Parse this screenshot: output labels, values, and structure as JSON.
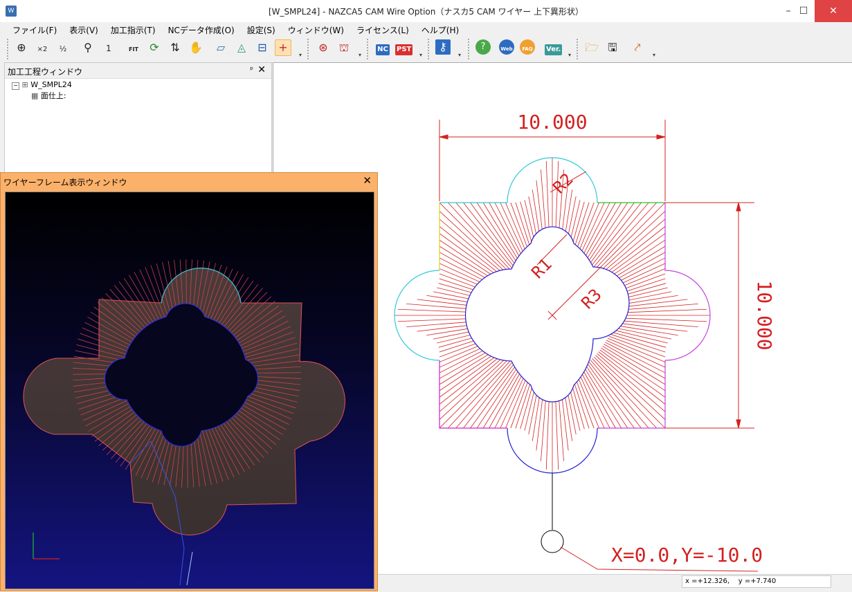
{
  "window": {
    "title": "[W_SMPL24] - NAZCA5 CAM Wire Option（ナスカ5 CAM ワイヤー 上下異形状）",
    "minimize": "–",
    "maximize": "☐",
    "close": "✕"
  },
  "menu": [
    "ファイル(F)",
    "表示(V)",
    "加工指示(T)",
    "NCデータ作成(O)",
    "設定(S)",
    "ウィンドウ(W)",
    "ライセンス(L)",
    "ヘルプ(H)"
  ],
  "toolbar": {
    "nc_label": "NC",
    "pst_label": "PST",
    "web_label": "Web",
    "faq_label": "FAQ",
    "ver_label": "Ver.",
    "fit_label": "FIT",
    "x2_label": "×2",
    "half_label": "½",
    "one_label": "1"
  },
  "process_panel": {
    "title": "加工工程ウィンドウ",
    "pin": "ᵖ",
    "close": "✕",
    "root": "W_SMPL24",
    "child": "面仕上:"
  },
  "wireframe_window": {
    "title": "ワイヤーフレーム表示ウィンドウ",
    "close": "✕"
  },
  "drawing": {
    "dim_width": "10.000",
    "dim_height": "10.000",
    "label_r1": "R1",
    "label_r2": "R2",
    "label_r3": "R3",
    "start_point": "X=0.0,Y=-10.0"
  },
  "status": {
    "x": "x =+12.326,",
    "y": "y =+7.740"
  }
}
